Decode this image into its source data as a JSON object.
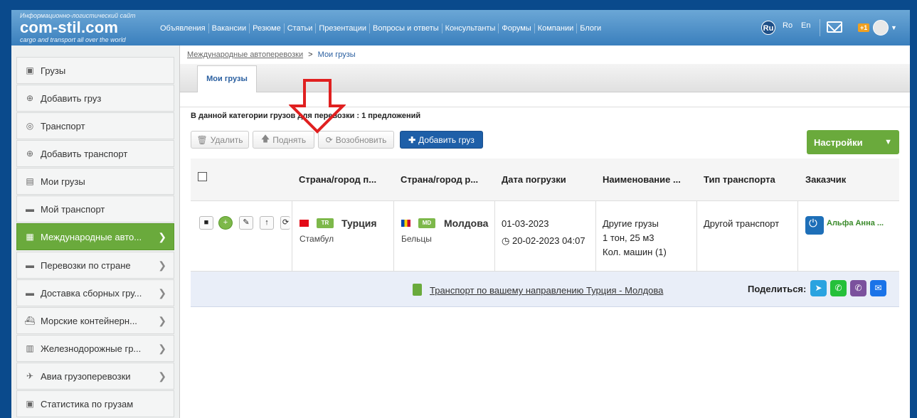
{
  "header": {
    "tagline": "Информационно-логистический сайт",
    "site_name": "com-stil.com",
    "slogan": "cargo and transport all over the world",
    "nav": [
      "Объявления",
      "Вакансии",
      "Резюме",
      "Статьи",
      "Презентации",
      "Вопросы и ответы",
      "Консультанты",
      "Форумы",
      "Компании",
      "Блоги"
    ],
    "lang_active": "Ru",
    "langs": [
      "Ro",
      "En"
    ],
    "notif_badge": "+1"
  },
  "sidebar": {
    "items": [
      {
        "label": "Грузы",
        "icon": "cube-icon"
      },
      {
        "label": "Добавить груз",
        "icon": "plus-circle-icon"
      },
      {
        "label": "Транспорт",
        "icon": "steering-icon"
      },
      {
        "label": "Добавить транспорт",
        "icon": "plus-circle-icon"
      },
      {
        "label": "Мои грузы",
        "icon": "clipboard-icon"
      },
      {
        "label": "Мой транспорт",
        "icon": "truck-icon"
      },
      {
        "label": "Международные авто...",
        "icon": "truck-front-icon",
        "active": true
      },
      {
        "label": "Перевозки по стране",
        "icon": "truck-icon"
      },
      {
        "label": "Доставка сборных гру...",
        "icon": "truck-icon"
      },
      {
        "label": "Морские контейнерн...",
        "icon": "ship-icon"
      },
      {
        "label": "Железнодорожные гр...",
        "icon": "train-icon"
      },
      {
        "label": "Авиа грузоперевозки",
        "icon": "plane-icon"
      },
      {
        "label": "Статистика по грузам",
        "icon": "cube-icon"
      }
    ]
  },
  "breadcrumb": {
    "parent": "Международные автоперевозки",
    "sep": ">",
    "current": "Мои грузы"
  },
  "tab": "Мои грузы",
  "count_text": "В данной категории грузов для перевозки : 1 предложений",
  "toolbar": {
    "delete": "Удалить",
    "raise": "Поднять",
    "renew": "Возобновить",
    "add": "Добавить груз",
    "settings": "Настройки"
  },
  "table": {
    "headers": [
      "Страна/город п...",
      "Страна/город р...",
      "Дата погрузки",
      "Наименование ...",
      "Тип транспорта",
      "Заказчик"
    ],
    "row": {
      "from_code": "TR",
      "from_country": "Турция",
      "from_city": "Стамбул",
      "to_code": "MD",
      "to_country": "Молдова",
      "to_city": "Бельцы",
      "load_date": "01-03-2023",
      "posted": "20-02-2023 04:07",
      "cargo_name": "Другие грузы",
      "cargo_weight": "1 тон, 25 м3",
      "cargo_machines": "Кол. машин (1)",
      "transport_type": "Другой транспорт",
      "customer": "Альфа Анна ..."
    }
  },
  "share": {
    "route": "Транспорт по вашему направлению Турция - Молдова",
    "label": "Поделиться:"
  },
  "colors": {
    "accent_green": "#6aaa3c",
    "primary_blue": "#1e5fa8",
    "arrow_red": "#e02020"
  }
}
